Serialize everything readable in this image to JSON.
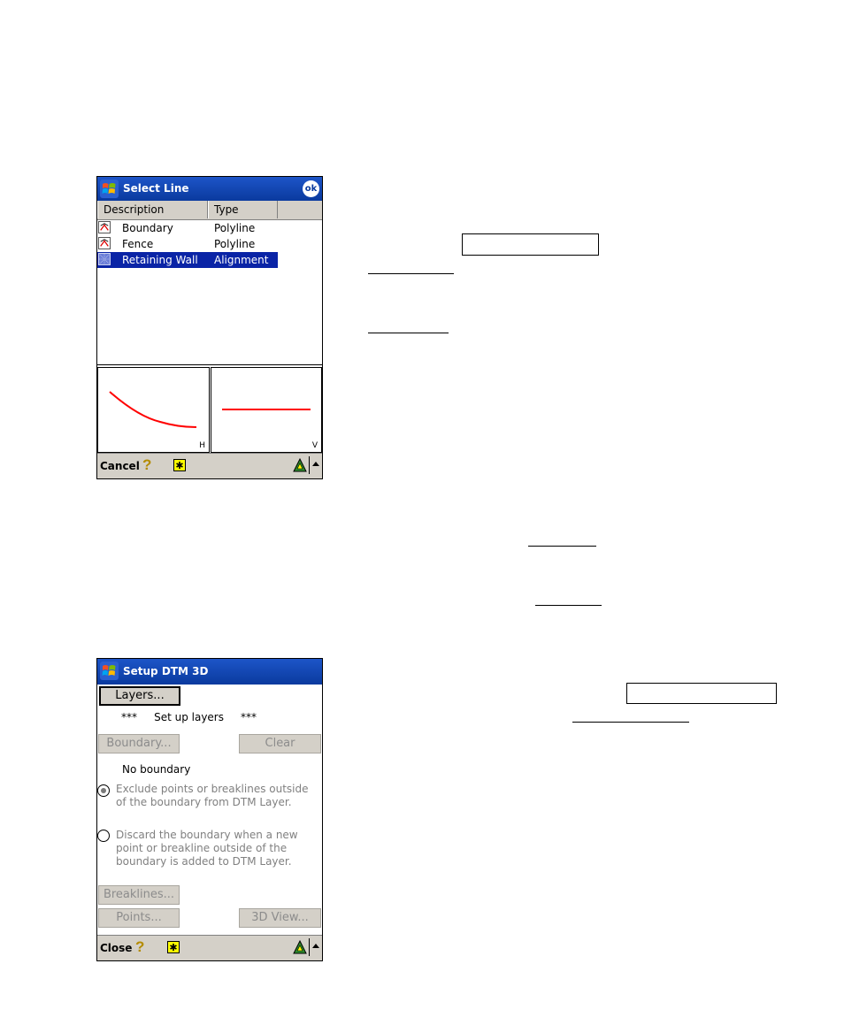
{
  "select_line": {
    "title": "Select Line",
    "ok_label": "ok",
    "columns": [
      "Description",
      "Type"
    ],
    "rows": [
      {
        "description": "Boundary",
        "type": "Polyline",
        "selected": false
      },
      {
        "description": "Fence",
        "type": "Polyline",
        "selected": false
      },
      {
        "description": "Retaining Wall",
        "type": "Alignment",
        "selected": true
      }
    ],
    "horizontal_view_label": "H",
    "vertical_view_label": "V",
    "cancel_label": "Cancel",
    "line_color": "#ff0000"
  },
  "setup_dtm": {
    "title": "Setup DTM 3D",
    "layers_button": "Layers...",
    "layers_status": "***     Set up layers     ***",
    "boundary_button": "Boundary...",
    "clear_button": "Clear",
    "boundary_status": "No boundary",
    "option_exclude": "Exclude points or breaklines outside of the boundary from DTM Layer.",
    "option_discard": "Discard the boundary when a new point or breakline outside of the boundary is added to DTM Layer.",
    "breaklines_button": "Breaklines...",
    "points_button": "Points...",
    "view3d_button": "3D View...",
    "close_label": "Close"
  },
  "colors": {
    "titlebar": "#0a3a9e",
    "selection": "#0a24a6",
    "chrome": "#d4d0c8"
  }
}
